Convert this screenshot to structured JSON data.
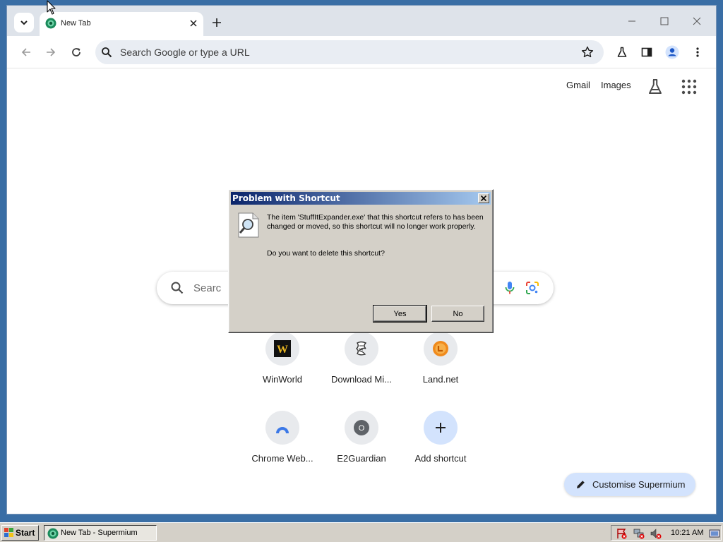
{
  "browser": {
    "tab": {
      "title": "New Tab"
    },
    "omnibox": {
      "placeholder": "Search Google or type a URL"
    }
  },
  "ntp": {
    "links": [
      "Gmail",
      "Images"
    ],
    "search_placeholder": "Searc",
    "shortcuts": [
      {
        "label": "WinWorld",
        "icon": "winworld-icon"
      },
      {
        "label": "Download Mi...",
        "icon": "download-icon"
      },
      {
        "label": "Land.net",
        "icon": "landnet-icon"
      },
      {
        "label": "Chrome Web...",
        "icon": "chrome-webstore-icon"
      },
      {
        "label": "E2Guardian",
        "icon": "e2guardian-icon"
      },
      {
        "label": "Add shortcut",
        "icon": "plus-icon"
      }
    ],
    "customise_label": "Customise Supermium"
  },
  "dialog": {
    "title": "Problem with Shortcut",
    "message": "The item 'StuffItExpander.exe' that this shortcut refers to has been changed or moved, so this shortcut will no longer work properly.",
    "question": "Do you want to delete this shortcut?",
    "yes_label": "Yes",
    "no_label": "No"
  },
  "taskbar": {
    "start_label": "Start",
    "task_label": "New Tab - Supermium",
    "clock": "10:21 AM"
  },
  "colors": {
    "desktop": "#3a6ea5",
    "title_gradient_start": "#0a246a",
    "customise_bg": "#d3e3fd"
  }
}
